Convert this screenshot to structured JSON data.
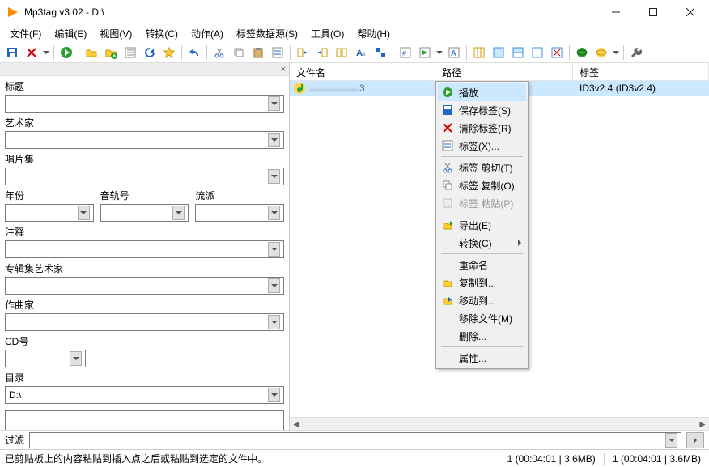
{
  "title": "Mp3tag v3.02  -  D:\\",
  "menu": [
    "文件(F)",
    "编辑(E)",
    "视图(V)",
    "转换(C)",
    "动作(A)",
    "标签数据源(S)",
    "工具(O)",
    "帮助(H)"
  ],
  "panel": {
    "title_label": "标题",
    "artist_label": "艺术家",
    "album_label": "唱片集",
    "year_label": "年份",
    "track_label": "音轨号",
    "genre_label": "流派",
    "comment_label": "注释",
    "albumartist_label": "专辑集艺术家",
    "composer_label": "作曲家",
    "cd_label": "CD号",
    "dir_label": "目录",
    "dir_value": "D:\\"
  },
  "columns": {
    "file": "文件名",
    "path": "路径",
    "tag": "标签"
  },
  "row": {
    "blurred_name": "▬▬▬▬▬",
    "num": "3",
    "tag": "ID3v2.4 (ID3v2.4)"
  },
  "ctx": {
    "play": "播放",
    "save": "保存标签(S)",
    "clear": "清除标签(R)",
    "tags": "标签(X)...",
    "cut": "标签 剪切(T)",
    "copy": "标签 复制(O)",
    "paste": "标签 粘贴(P)",
    "export": "导出(E)",
    "convert": "转换(C)",
    "rename": "重命名",
    "copyto": "复制到...",
    "moveto": "移动到...",
    "remove": "移除文件(M)",
    "delete": "删除...",
    "props": "属性..."
  },
  "filter_label": "过滤",
  "status_msg": "已剪贴板上的内容粘贴到插入点之后或粘贴到选定的文件中。",
  "status_r1": "1 (00:04:01 | 3.6MB)",
  "status_r2": "1 (00:04:01 | 3.6MB)"
}
